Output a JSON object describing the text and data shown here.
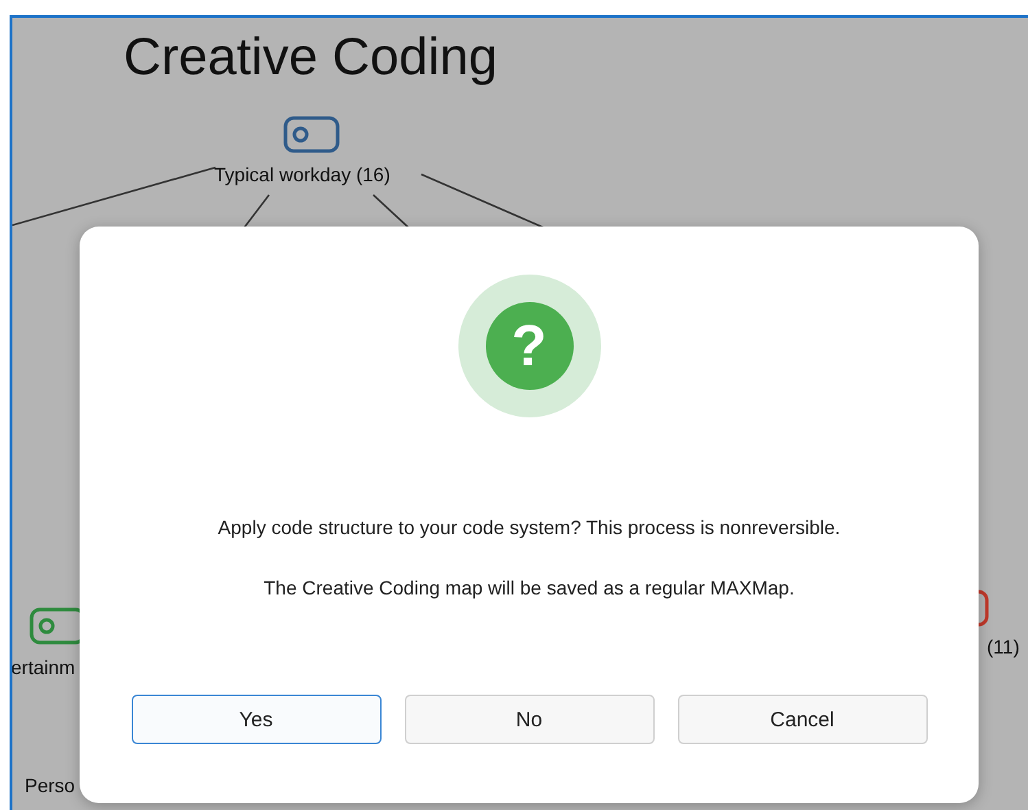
{
  "map": {
    "title": "Creative Coding",
    "nodes": [
      {
        "label": "Typical workday (16)",
        "color": "#2f5b8a"
      },
      {
        "label": "ertainm",
        "color": "#2e8b3e"
      },
      {
        "label": "Perso"
      },
      {
        "label": "(11)",
        "color": "#c0392b"
      }
    ]
  },
  "dialog": {
    "icon_glyph": "?",
    "message": "Apply code structure to your code system? This process is nonreversible.",
    "note": "The Creative Coding map will be saved as a regular MAXMap.",
    "buttons": [
      {
        "label": "Yes",
        "selected": true
      },
      {
        "label": "No",
        "selected": false
      },
      {
        "label": "Cancel",
        "selected": false
      }
    ]
  }
}
